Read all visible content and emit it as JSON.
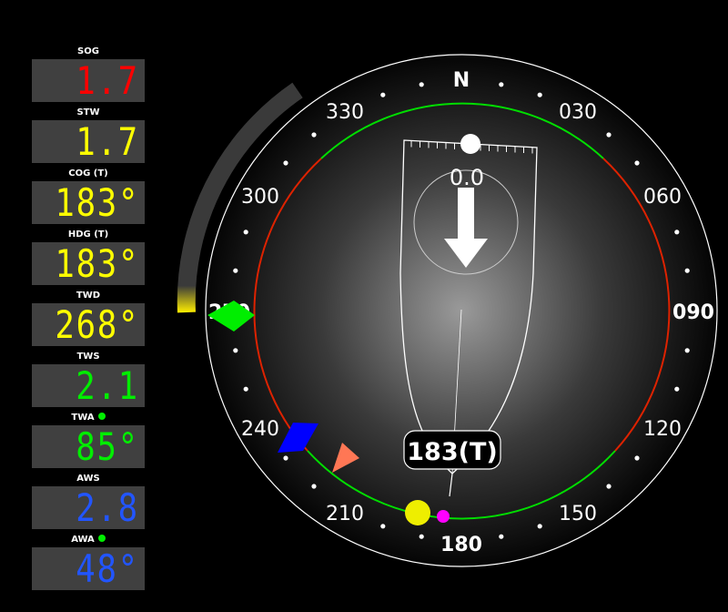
{
  "panels": [
    {
      "label": "SOG",
      "value": "1.7",
      "color": "#ff0000",
      "dot": false
    },
    {
      "label": "STW",
      "value": "1.7",
      "color": "#ffff00",
      "dot": false
    },
    {
      "label": "COG (T)",
      "value": "183°",
      "color": "#ffff00",
      "dot": false
    },
    {
      "label": "HDG (T)",
      "value": "183°",
      "color": "#ffff00",
      "dot": false
    },
    {
      "label": "TWD",
      "value": "268°",
      "color": "#ffff00",
      "dot": false
    },
    {
      "label": "TWS",
      "value": "2.1",
      "color": "#00ee00",
      "dot": false
    },
    {
      "label": "TWA",
      "value": "85°",
      "color": "#00ee00",
      "dot": true
    },
    {
      "label": "AWS",
      "value": "2.8",
      "color": "#2255ff",
      "dot": false
    },
    {
      "label": "AWA",
      "value": "48°",
      "color": "#2255ff",
      "dot": true
    }
  ],
  "dial": {
    "north_label": "N",
    "ring_labels": {
      "r330": "330",
      "r030": "030",
      "r300": "300",
      "r060": "060",
      "r270": "270",
      "r090": "090",
      "r240": "240",
      "r120": "120",
      "r210": "210",
      "r150": "150",
      "r180": "180"
    },
    "heading_readout": "183(T)",
    "drift_value": "0.0"
  },
  "colors": {
    "starboard": "#00dd00",
    "port": "#dd2200",
    "ring": "#ffffff"
  }
}
